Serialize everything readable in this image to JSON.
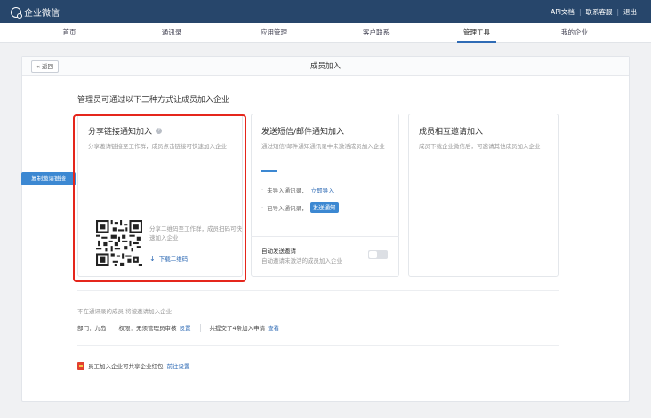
{
  "app": {
    "name": "企业微信"
  },
  "toplinks": [
    "API文档",
    "联系客服",
    "退出"
  ],
  "nav": {
    "items": [
      "首页",
      "通讯录",
      "应用管理",
      "客户联系",
      "管理工具",
      "我的企业"
    ],
    "active_index": 4
  },
  "page": {
    "back_label": "« 返回",
    "title": "成员加入",
    "intro": "管理员可通过以下三种方式让成员加入企业"
  },
  "option1": {
    "title": "分享链接通知加入",
    "help_icon": "?",
    "desc": "分享邀请链接至工作群，成员点击链接可快速加入企业",
    "copy_button": "复制邀请链接",
    "qr_text": "分享二维码至工作群，成员扫码可快速加入企业",
    "download_qr": "下载二维码",
    "download_icon": "↓"
  },
  "option2": {
    "title": "发送短信/邮件通知加入",
    "desc": "通过短信/邮件通知通讯录中未激活成员加入企业",
    "step1_text": "未导入通讯录，",
    "step1_link": "立即导入",
    "step2_text": "已导入通讯录，",
    "step2_button": "发送通知",
    "auto_title": "自动发送邀请",
    "auto_desc": "自动邀请未激活的成员加入企业",
    "auto_enabled": false
  },
  "option3": {
    "title": "成员相互邀请加入",
    "desc": "成员下载企业微信后，可邀请其他成员加入企业"
  },
  "footer": {
    "not_in_list": "不在通讯录的成员 将被邀请加入企业",
    "dept_label": "部门：九岛",
    "perm_label": "权限：无须管理员审核",
    "perm_link": "设置",
    "shared_text": "共提交了4条加入申请",
    "shared_link": "查看",
    "redpack_text": "员工加入企业可共享企业红包",
    "redpack_link": "前往设置"
  },
  "colors": {
    "topbar": "#27466b",
    "accent": "#3c88d2",
    "link": "#2f6bb5",
    "highlight": "#e5261c"
  }
}
